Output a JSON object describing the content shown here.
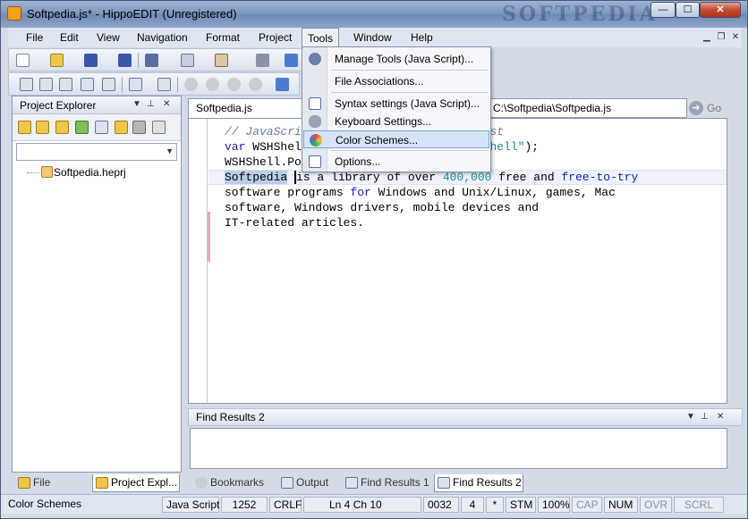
{
  "window": {
    "title": "Softpedia.js* - HippoEDIT (Unregistered)",
    "watermark": "SOFTPEDIA",
    "minimize": "—",
    "maximize": "☐",
    "close": "✕"
  },
  "menubar": {
    "items": [
      "File",
      "Edit",
      "View",
      "Navigation",
      "Format",
      "Project",
      "Tools",
      "Window",
      "Help"
    ],
    "active": "Tools"
  },
  "tools_menu": {
    "items": [
      {
        "label": "Manage Tools (Java Script)...",
        "icon": "gear-icon"
      },
      {
        "label": "File Associations...",
        "icon": "none"
      },
      {
        "label": "Syntax settings (Java Script)...",
        "icon": "syntax-icon"
      },
      {
        "label": "Keyboard Settings...",
        "icon": "keyboard-icon"
      },
      {
        "label": "Color Schemes...",
        "icon": "palette-icon",
        "highlighted": true
      },
      {
        "label": "Options...",
        "icon": "checklist-icon"
      }
    ]
  },
  "project_explorer": {
    "title": "Project Explorer",
    "tree": [
      {
        "label": "Softpedia.heprj",
        "icon": "project-file-icon"
      }
    ]
  },
  "editor": {
    "tab": "Softpedia.js",
    "path": "C:\\Softpedia\\Softpedia.js",
    "go_label": "Go",
    "lines": [
      [
        {
          "t": "// JavaScri",
          "c": "comment"
        },
        {
          "t": "                  ",
          "c": ""
        },
        {
          "t": "Script Host",
          "c": "comment"
        }
      ],
      [
        {
          "t": "var",
          "c": "kw"
        },
        {
          "t": " WSHShel",
          "c": ""
        },
        {
          "t": "                  ",
          "c": ""
        },
        {
          "t": "WScript.Shell\"",
          "c": "str"
        },
        {
          "t": ");",
          "c": ""
        }
      ],
      [
        {
          "t": "WSHShell.Po",
          "c": ""
        }
      ],
      [
        {
          "t": "Softpedia",
          "c": "sel"
        },
        {
          "t": " ",
          "c": "caret"
        },
        {
          "t": "is a library of over ",
          "c": ""
        },
        {
          "t": "400,000",
          "c": "num"
        },
        {
          "t": " free and ",
          "c": ""
        },
        {
          "t": "free-to-try",
          "c": "kw"
        }
      ],
      [
        {
          "t": "software programs ",
          "c": ""
        },
        {
          "t": "for",
          "c": "kw"
        },
        {
          "t": " Windows and Unix/Linux, games, Mac",
          "c": ""
        }
      ],
      [
        {
          "t": "software, Windows drivers, mobile devices and",
          "c": ""
        }
      ],
      [
        {
          "t": "IT-related articles.",
          "c": ""
        }
      ]
    ]
  },
  "find_results": {
    "title": "Find Results 2"
  },
  "bottom_tabs": {
    "left": [
      {
        "label": "File Explorer",
        "icon": "folder-icon",
        "active": false
      },
      {
        "label": "Project Expl...",
        "icon": "project-icon",
        "active": true
      }
    ],
    "right": [
      {
        "label": "Bookmarks",
        "icon": "bookmark-icon",
        "active": false
      },
      {
        "label": "Output",
        "icon": "output-icon",
        "active": false
      },
      {
        "label": "Find Results 1",
        "icon": "find-icon",
        "active": false
      },
      {
        "label": "Find Results 2",
        "icon": "find-icon",
        "active": true
      }
    ]
  },
  "statusbar": {
    "message": "Color Schemes",
    "language": "Java Script",
    "size": "1252",
    "eol": "CRLF",
    "position": "Ln  4 Ch 10",
    "code": "0032",
    "tab": "4",
    "modified": "*",
    "stm": "STM",
    "zoom": "100%",
    "cap": "CAP",
    "num": "NUM",
    "ovr": "OVR",
    "scrl": "SCRL"
  },
  "colors": {
    "accent": "#7fa2d4",
    "keyword": "#1a1ab8",
    "string": "#1a8a8a",
    "comment": "#6b7f99"
  }
}
